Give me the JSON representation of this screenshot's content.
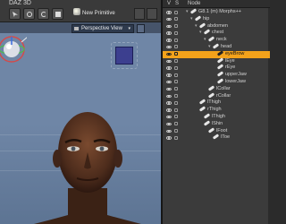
{
  "viewport": {
    "menu_fragment": "DAZ 3D",
    "new_primitive_label": "New Primitive",
    "view_selector_label": "Perspective View",
    "view_selector_arrow": "▾"
  },
  "scene": {
    "columns": {
      "visible": "V",
      "selectable": "S",
      "node": "Node"
    },
    "tree": [
      {
        "label": "G8.1 (m) Morphs++",
        "depth": 0,
        "expanded": true,
        "selected": false
      },
      {
        "label": "hip",
        "depth": 1,
        "expanded": true,
        "selected": false
      },
      {
        "label": "abdomen",
        "depth": 2,
        "expanded": true,
        "selected": false
      },
      {
        "label": "chest",
        "depth": 3,
        "expanded": true,
        "selected": false
      },
      {
        "label": "neck",
        "depth": 4,
        "expanded": true,
        "selected": false
      },
      {
        "label": "head",
        "depth": 5,
        "expanded": true,
        "selected": false
      },
      {
        "label": "eyeBrow",
        "depth": 6,
        "expanded": false,
        "selected": true
      },
      {
        "label": "lEye",
        "depth": 6,
        "expanded": false,
        "selected": false
      },
      {
        "label": "rEye",
        "depth": 6,
        "expanded": false,
        "selected": false
      },
      {
        "label": "upperJaw",
        "depth": 6,
        "expanded": false,
        "selected": false
      },
      {
        "label": "lowerJaw",
        "depth": 6,
        "expanded": false,
        "selected": false
      },
      {
        "label": "lCollar",
        "depth": 4,
        "expanded": false,
        "selected": false
      },
      {
        "label": "rCollar",
        "depth": 4,
        "expanded": false,
        "selected": false
      },
      {
        "label": "lThigh",
        "depth": 2,
        "expanded": false,
        "selected": false
      },
      {
        "label": "rThigh",
        "depth": 2,
        "expanded": false,
        "selected": false
      },
      {
        "label": "lThigh",
        "depth": 3,
        "expanded": false,
        "selected": false
      },
      {
        "label": "lShin",
        "depth": 3,
        "expanded": false,
        "selected": false
      },
      {
        "label": "lFoot",
        "depth": 4,
        "expanded": false,
        "selected": false
      },
      {
        "label": "lToe",
        "depth": 5,
        "expanded": false,
        "selected": false
      }
    ]
  },
  "colors": {
    "selection": "#f3a21b",
    "viewport_bg": "#6f86a6",
    "panel_bg": "#3b3b3b"
  }
}
